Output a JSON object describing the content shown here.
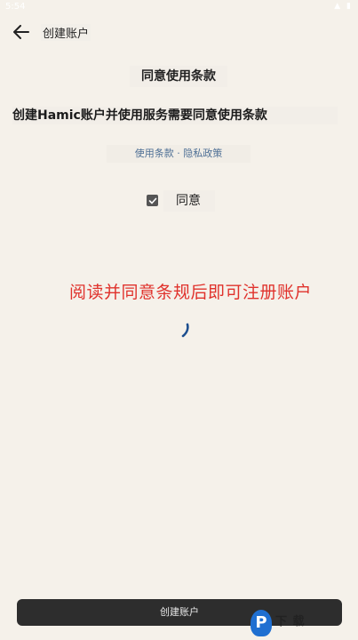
{
  "status_bar": {
    "time": "5:54",
    "icons": [
      "signal-icon",
      "battery-icon"
    ]
  },
  "app_bar": {
    "title": "创建账户",
    "back_icon": "arrow-left-icon"
  },
  "content": {
    "section_title": "同意使用条款",
    "terms_statement": "创建Hamic账户并使用服务需要同意使用条款",
    "terms_link": "使用条款 · 隐私政策",
    "agree_label": "同意",
    "agree_checked": true,
    "annotation": "阅读并同意条规后即可注册账户"
  },
  "footer": {
    "create_button_label": "创建账户"
  },
  "watermark": {
    "badge": "P",
    "text": "下 载"
  },
  "colors": {
    "background": "#f5f1ea",
    "annotation": "#e0322c",
    "link": "#4e6f95",
    "button": "#2d2d2d",
    "spinner": "#1d4f8f"
  }
}
